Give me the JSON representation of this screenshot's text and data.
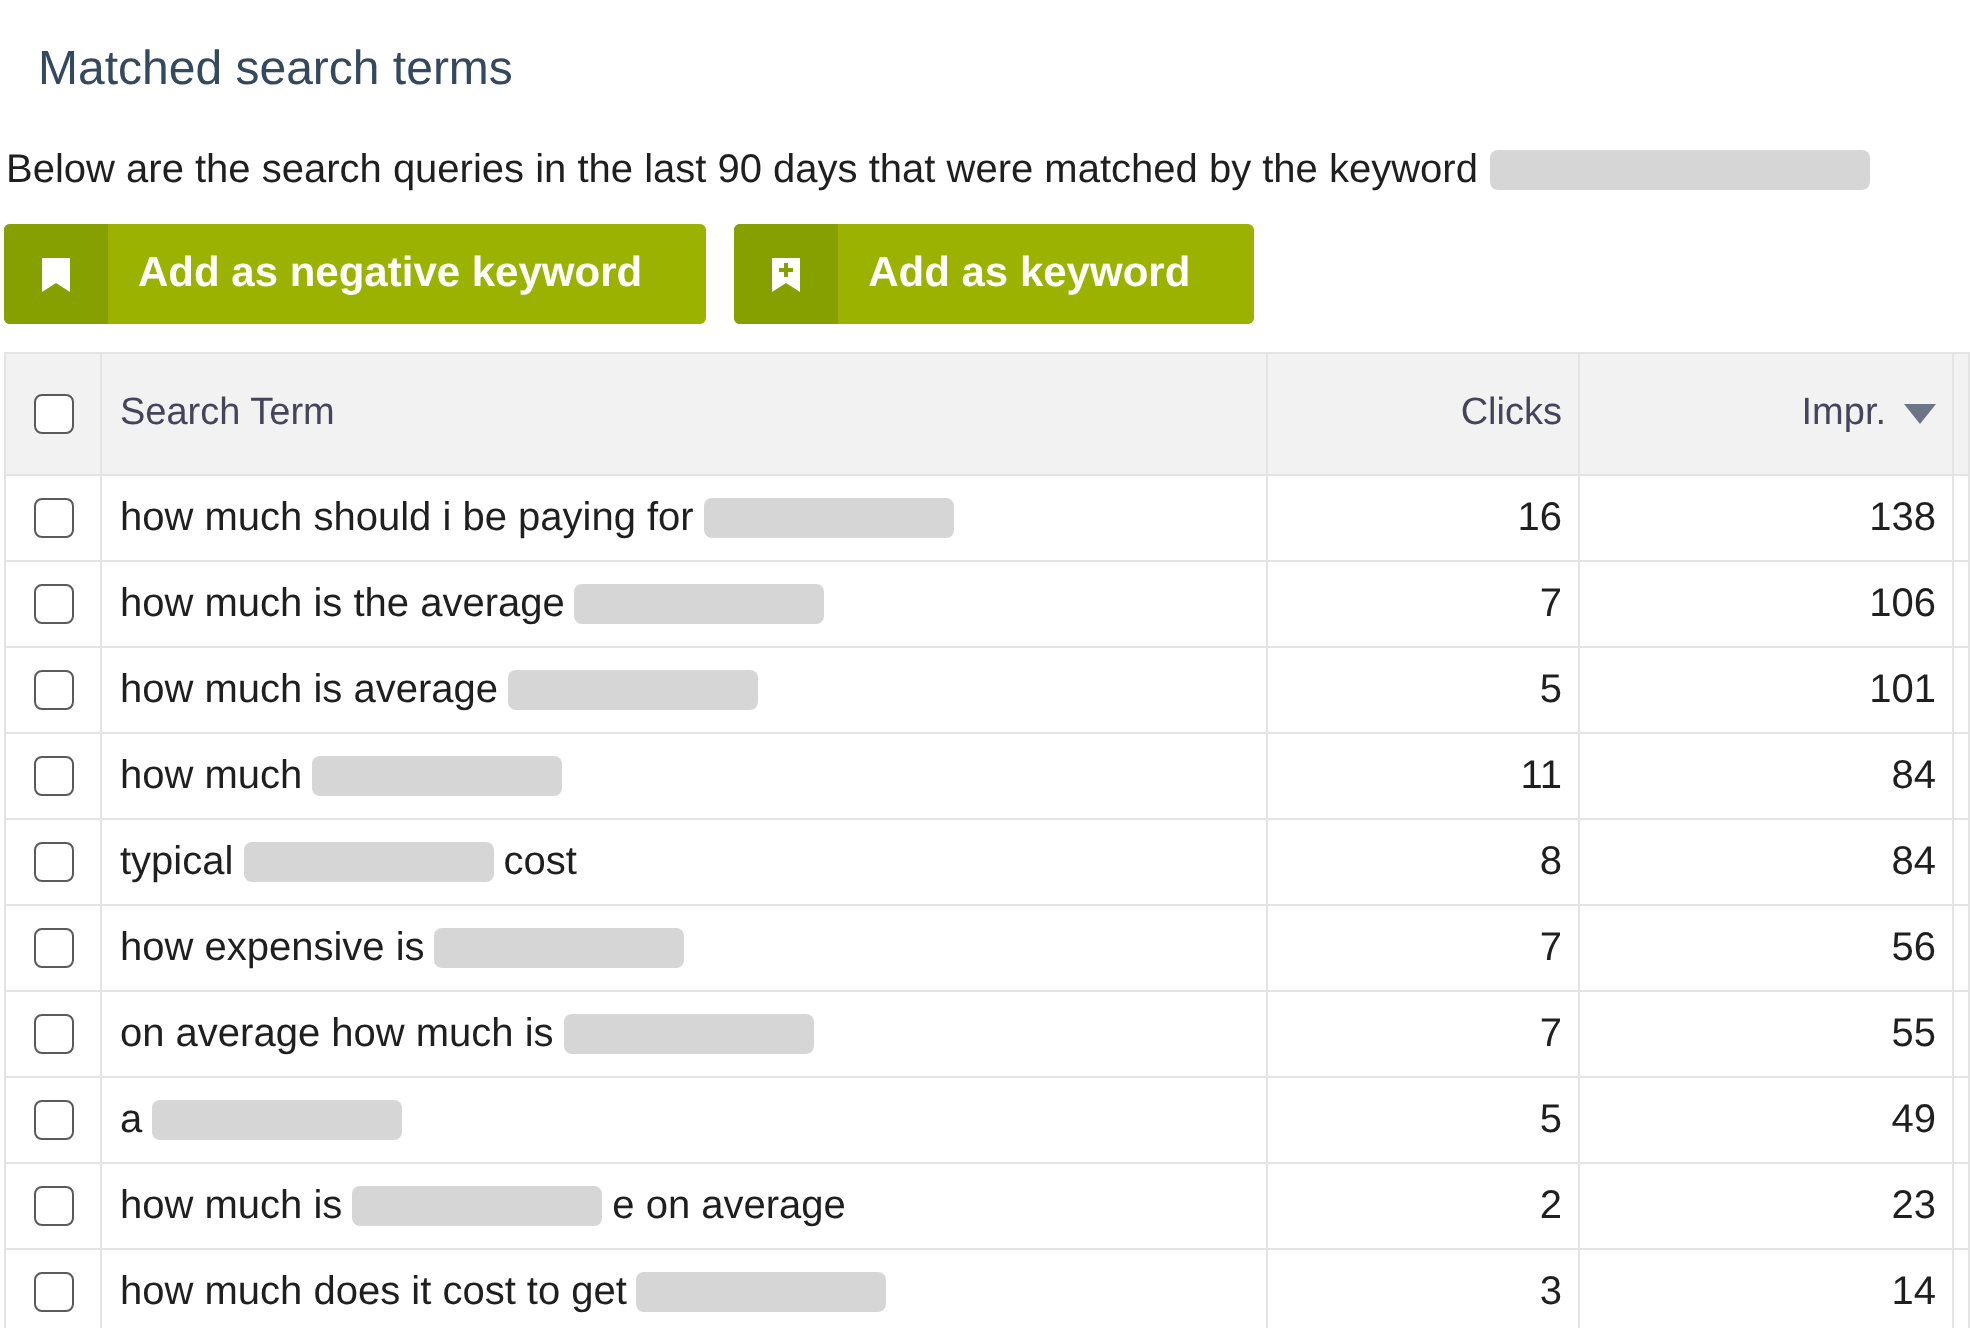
{
  "section": {
    "title": "Matched search terms",
    "description": [
      {
        "kind": "text",
        "text": "Below are the search queries in the last 90 days that were matched by the keyword"
      },
      {
        "kind": "redacted"
      }
    ]
  },
  "buttons": [
    {
      "kind": "negative",
      "label": "Add as negative keyword"
    },
    {
      "kind": "keyword",
      "label": "Add as keyword"
    }
  ],
  "table": {
    "select_all": {
      "checked": false
    },
    "columns": [
      {
        "kind": "text",
        "label": "Search Term",
        "sorted": false
      },
      {
        "kind": "number",
        "label": "Clicks",
        "sorted": false
      },
      {
        "kind": "number",
        "label": "Impr.",
        "sorted": true
      }
    ],
    "rows": [
      {
        "checked": false,
        "term": [
          {
            "kind": "text",
            "text": "how much should i be paying for"
          },
          {
            "kind": "redacted"
          }
        ],
        "clicks": "16",
        "impressions": "138"
      },
      {
        "checked": false,
        "term": [
          {
            "kind": "text",
            "text": "how much is the average"
          },
          {
            "kind": "redacted"
          }
        ],
        "clicks": "7",
        "impressions": "106"
      },
      {
        "checked": false,
        "term": [
          {
            "kind": "text",
            "text": "how much is average"
          },
          {
            "kind": "redacted"
          }
        ],
        "clicks": "5",
        "impressions": "101"
      },
      {
        "checked": false,
        "term": [
          {
            "kind": "text",
            "text": "how much"
          },
          {
            "kind": "redacted"
          }
        ],
        "clicks": "11",
        "impressions": "84"
      },
      {
        "checked": false,
        "term": [
          {
            "kind": "text",
            "text": "typical"
          },
          {
            "kind": "redacted"
          },
          {
            "kind": "text",
            "text": "cost"
          }
        ],
        "clicks": "8",
        "impressions": "84"
      },
      {
        "checked": false,
        "term": [
          {
            "kind": "text",
            "text": "how expensive is"
          },
          {
            "kind": "redacted"
          }
        ],
        "clicks": "7",
        "impressions": "56"
      },
      {
        "checked": false,
        "term": [
          {
            "kind": "text",
            "text": "on average how much is"
          },
          {
            "kind": "redacted"
          }
        ],
        "clicks": "7",
        "impressions": "55"
      },
      {
        "checked": false,
        "term": [
          {
            "kind": "text",
            "text": "a"
          },
          {
            "kind": "redacted"
          }
        ],
        "clicks": "5",
        "impressions": "49"
      },
      {
        "checked": false,
        "term": [
          {
            "kind": "text",
            "text": "how much is"
          },
          {
            "kind": "redacted"
          },
          {
            "kind": "text",
            "text": "e on average"
          }
        ],
        "clicks": "2",
        "impressions": "23"
      },
      {
        "checked": false,
        "term": [
          {
            "kind": "text",
            "text": "how much does it cost to get"
          },
          {
            "kind": "redacted"
          }
        ],
        "clicks": "3",
        "impressions": "14"
      }
    ]
  }
}
